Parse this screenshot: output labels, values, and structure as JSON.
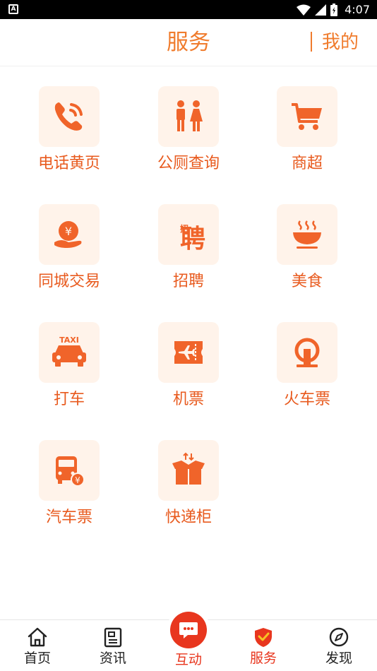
{
  "status": {
    "notif": "A",
    "time": "4:07"
  },
  "header": {
    "title": "服务",
    "mine": "我的"
  },
  "services": [
    {
      "label": "电话黄页",
      "icon": "phone-icon"
    },
    {
      "label": "公厕查询",
      "icon": "restroom-icon"
    },
    {
      "label": "商超",
      "icon": "shopping-cart-icon"
    },
    {
      "label": "同城交易",
      "icon": "hand-money-icon"
    },
    {
      "label": "招聘",
      "icon": "recruit-icon",
      "glyph": "聘",
      "glyph_small": "招"
    },
    {
      "label": "美食",
      "icon": "food-bowl-icon"
    },
    {
      "label": "打车",
      "icon": "taxi-icon",
      "glyph": "TAXI"
    },
    {
      "label": "机票",
      "icon": "plane-ticket-icon"
    },
    {
      "label": "火车票",
      "icon": "train-icon"
    },
    {
      "label": "汽车票",
      "icon": "bus-ticket-icon",
      "glyph": "¥"
    },
    {
      "label": "快递柜",
      "icon": "parcel-box-icon"
    }
  ],
  "nav": {
    "home": "首页",
    "news": "资讯",
    "interact": "互动",
    "service": "服务",
    "discover": "发现"
  },
  "colors": {
    "accent": "#f07c2d",
    "label": "#e85a1e",
    "active": "#e8361e",
    "tile_bg": "#fff3ea"
  }
}
